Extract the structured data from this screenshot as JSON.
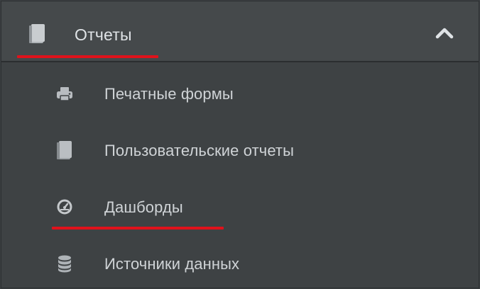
{
  "menu": {
    "title": "Отчеты",
    "title_icon": "book-icon",
    "collapse_icon": "chevron-up-icon",
    "items": [
      {
        "label": "Печатные формы",
        "icon": "printer-icon"
      },
      {
        "label": "Пользовательские отчеты",
        "icon": "book-icon"
      },
      {
        "label": "Дашборды",
        "icon": "dashboard-gauge-icon"
      },
      {
        "label": "Источники данных",
        "icon": "database-icon"
      }
    ]
  },
  "colors": {
    "background": "#3e4244",
    "header_background": "#45494b",
    "highlight_underline": "#e0121b",
    "text": "#cfd3d6"
  }
}
